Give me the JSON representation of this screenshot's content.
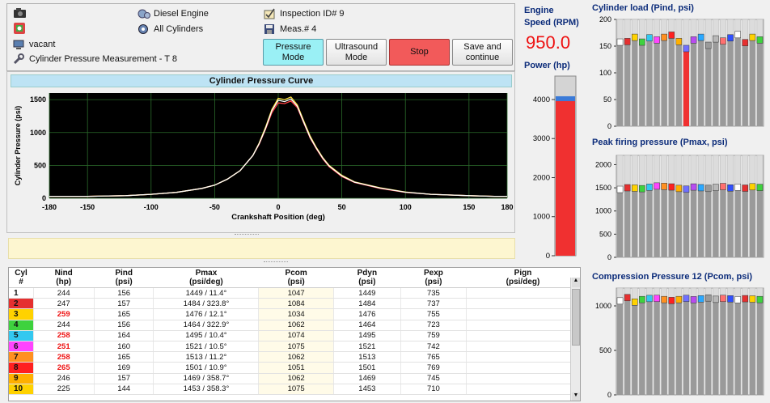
{
  "header": {
    "engine_type": "Diesel Engine",
    "cylinders_mode": "All Cylinders",
    "status": "vacant",
    "measurement_title": "Cylinder Pressure Measurement - T 8",
    "inspection": "Inspection ID# 9",
    "meas": "Meas.# 4"
  },
  "buttons": {
    "pressure_mode": "Pressure\nMode",
    "ultrasound_mode": "Ultrasound\nMode",
    "stop": "Stop",
    "save_continue": "Save and\ncontinue"
  },
  "engine": {
    "speed_label": "Engine\nSpeed (RPM)",
    "speed_value": "950.0",
    "power_label": "Power (hp)",
    "power_ticks": [
      "4000",
      "3000",
      "2000",
      "1000",
      "0"
    ],
    "power_value": 4000,
    "power_max": 4600
  },
  "colors": {
    "cyl": [
      "#ffffff",
      "#e53030",
      "#ffd200",
      "#3ed23e",
      "#33c8f0",
      "#ff44ff",
      "#ff9020",
      "#ff2020",
      "#ffb000",
      "#7070ff",
      "#b84cf0",
      "#2aa8ff",
      "#9a9a9a",
      "#b8b8b8",
      "#ff7070",
      "#3050ff"
    ]
  },
  "chart_data": [
    {
      "type": "line",
      "title": "Cylinder Pressure Curve",
      "xlabel": "Crankshaft Position (deg)",
      "ylabel": "Cylinder Pressure (psi)",
      "xlim": [
        -180,
        180
      ],
      "ylim": [
        0,
        1600
      ],
      "xticks": [
        "-180",
        "-150",
        "-100",
        "-50",
        "0",
        "50",
        "100",
        "150",
        "180"
      ],
      "yticks": [
        "0",
        "500",
        "1000",
        "1500"
      ],
      "grid": true,
      "x": [
        -180,
        -150,
        -120,
        -100,
        -80,
        -60,
        -50,
        -40,
        -30,
        -20,
        -15,
        -10,
        -5,
        0,
        5,
        10,
        15,
        20,
        25,
        30,
        35,
        40,
        50,
        60,
        80,
        100,
        120,
        150,
        170,
        180
      ],
      "series": [
        {
          "values": [
            30,
            30,
            40,
            60,
            90,
            150,
            200,
            290,
            420,
            650,
            820,
            1050,
            1300,
            1450,
            1440,
            1480,
            1380,
            1150,
            920,
            750,
            600,
            480,
            330,
            240,
            150,
            90,
            60,
            40,
            30,
            30
          ]
        },
        {
          "values": [
            30,
            30,
            40,
            60,
            90,
            150,
            200,
            290,
            420,
            650,
            840,
            1080,
            1350,
            1520,
            1500,
            1540,
            1420,
            1180,
            950,
            770,
            620,
            500,
            350,
            250,
            160,
            95,
            60,
            40,
            30,
            30
          ]
        },
        {
          "values": [
            30,
            30,
            40,
            60,
            90,
            150,
            200,
            290,
            420,
            650,
            830,
            1060,
            1330,
            1490,
            1470,
            1510,
            1400,
            1160,
            930,
            760,
            610,
            490,
            340,
            245,
            155,
            92,
            60,
            40,
            30,
            30
          ]
        }
      ]
    },
    {
      "type": "bar",
      "title": "Cylinder load (Pind, psi)",
      "ylim": [
        0,
        200
      ],
      "yticks": [
        "200",
        "150",
        "100",
        "50",
        "0"
      ],
      "values": [
        156,
        157,
        165,
        156,
        164,
        160,
        165,
        169,
        157,
        144,
        160,
        165,
        150,
        162,
        158,
        164,
        170,
        155,
        165,
        160
      ]
    },
    {
      "type": "bar",
      "title": "Peak firing pressure (Pmax, psi)",
      "ylim": [
        0,
        2200
      ],
      "yticks": [
        "2000",
        "1500",
        "1000",
        "500",
        "0"
      ],
      "values": [
        1449,
        1484,
        1476,
        1464,
        1495,
        1521,
        1513,
        1501,
        1469,
        1453,
        1500,
        1485,
        1470,
        1490,
        1510,
        1480,
        1495,
        1475,
        1505,
        1490
      ]
    },
    {
      "type": "bar",
      "title": "Compression Pressure 12 (Pcom, psi)",
      "ylim": [
        0,
        1200
      ],
      "yticks": [
        "1000",
        "500",
        "0"
      ],
      "values": [
        1047,
        1084,
        1034,
        1062,
        1074,
        1075,
        1062,
        1051,
        1062,
        1075,
        1060,
        1070,
        1080,
        1065,
        1075,
        1070,
        1060,
        1072,
        1068,
        1062
      ]
    }
  ],
  "table": {
    "columns": [
      "Cyl\n#",
      "Nind\n(hp)",
      "Pind\n(psi)",
      "Pmax\n(psi/deg)",
      "Pcom\n(psi)",
      "Pdyn\n(psi)",
      "Pexp\n(psi)",
      "Pign\n(psi/deg)"
    ],
    "rows": [
      {
        "cyl": "1",
        "nind": "244",
        "pind": "156",
        "pmax": "1449 / 11.4°",
        "pcom": "1047",
        "pdyn": "1449",
        "pexp": "735",
        "pign": "",
        "hi": false
      },
      {
        "cyl": "2",
        "nind": "247",
        "pind": "157",
        "pmax": "1484 / 323.8°",
        "pcom": "1084",
        "pdyn": "1484",
        "pexp": "737",
        "pign": "",
        "hi": false
      },
      {
        "cyl": "3",
        "nind": "259",
        "pind": "165",
        "pmax": "1476 / 12.1°",
        "pcom": "1034",
        "pdyn": "1476",
        "pexp": "755",
        "pign": "",
        "hi": true
      },
      {
        "cyl": "4",
        "nind": "244",
        "pind": "156",
        "pmax": "1464 / 322.9°",
        "pcom": "1062",
        "pdyn": "1464",
        "pexp": "723",
        "pign": "",
        "hi": false
      },
      {
        "cyl": "5",
        "nind": "258",
        "pind": "164",
        "pmax": "1495 / 10.4°",
        "pcom": "1074",
        "pdyn": "1495",
        "pexp": "759",
        "pign": "",
        "hi": true
      },
      {
        "cyl": "6",
        "nind": "251",
        "pind": "160",
        "pmax": "1521 / 10.5°",
        "pcom": "1075",
        "pdyn": "1521",
        "pexp": "742",
        "pign": "",
        "hi": true
      },
      {
        "cyl": "7",
        "nind": "258",
        "pind": "165",
        "pmax": "1513 / 11.2°",
        "pcom": "1062",
        "pdyn": "1513",
        "pexp": "765",
        "pign": "",
        "hi": true
      },
      {
        "cyl": "8",
        "nind": "265",
        "pind": "169",
        "pmax": "1501 / 10.9°",
        "pcom": "1051",
        "pdyn": "1501",
        "pexp": "769",
        "pign": "",
        "hi": true
      },
      {
        "cyl": "9",
        "nind": "246",
        "pind": "157",
        "pmax": "1469 / 358.7°",
        "pcom": "1062",
        "pdyn": "1469",
        "pexp": "745",
        "pign": "",
        "hi": false
      },
      {
        "cyl": "10",
        "nind": "225",
        "pind": "144",
        "pmax": "1453 / 358.3°",
        "pcom": "1075",
        "pdyn": "1453",
        "pexp": "710",
        "pign": "",
        "hi": false
      }
    ],
    "cyl_colors": [
      "#ffffff",
      "#e53030",
      "#ffd200",
      "#3ed23e",
      "#33c8f0",
      "#ff44ff",
      "#ff9020",
      "#ff2020",
      "#ffb000",
      "#ffd200"
    ]
  }
}
